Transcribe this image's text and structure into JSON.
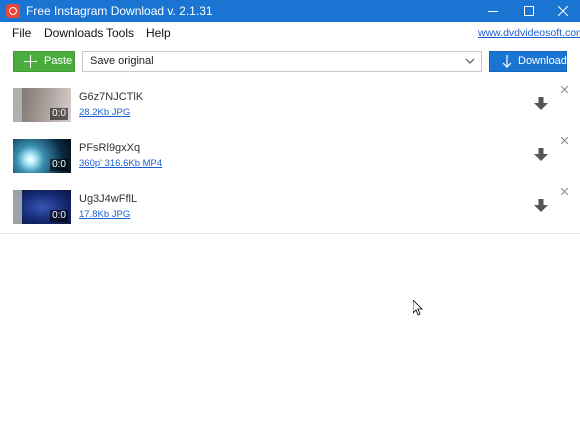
{
  "window": {
    "title": "Free Instagram Download v. 2.1.31",
    "icon": "camera-icon"
  },
  "menu": {
    "items": [
      "File",
      "Downloads",
      "Tools",
      "Help"
    ],
    "site_link": "www.dvdvideosoft.com"
  },
  "toolbar": {
    "paste_label": "Paste",
    "format_value": "Save original",
    "download_label": "Download"
  },
  "items": [
    {
      "name": "G6z7NJCTlK",
      "meta": "28.2Kb JPG",
      "duration": "0:0"
    },
    {
      "name": "PFsRl9gxXq",
      "meta": "360p' 316.6Kb MP4",
      "duration": "0:0"
    },
    {
      "name": "Ug3J4wFflL",
      "meta": "17.8Kb JPG",
      "duration": "0:0"
    }
  ],
  "colors": {
    "accent": "#1a74d1",
    "paste_green": "#4aad3d",
    "link": "#1a5fd0"
  }
}
